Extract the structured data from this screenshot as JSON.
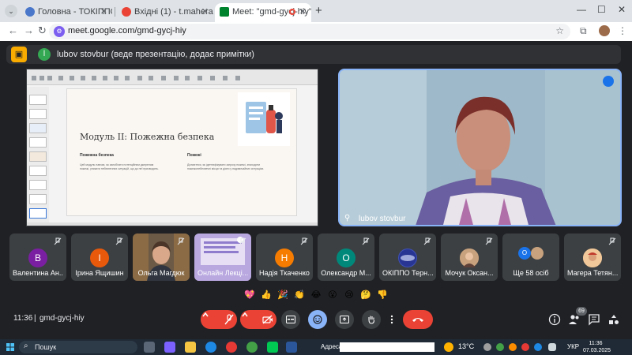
{
  "browser": {
    "tabs": [
      {
        "title": "Головна - ТОКІППО",
        "active": false,
        "favicon_color": "#4a77c9"
      },
      {
        "title": "Вхідні (1) - t.mahera@ippo.ed...",
        "active": false,
        "favicon_color": "#ea4335"
      },
      {
        "title": "Meet: \"gmd-gycj-hiy\"",
        "active": true,
        "favicon_color": "#00832d"
      }
    ],
    "url": "meet.google.com/gmd-gycj-hiy"
  },
  "presentation_bar": {
    "initial": "l",
    "text": "lubov stovbur (веде презентацію, додає примітки)"
  },
  "slide": {
    "title": "Модуль ІІ: Пожежна безпека",
    "left_heading": "Пожежна безпека",
    "left_text": "Цей модуль навчає, як запобігати потенційним джерелам пожежі, уникати небезпечних ситуацій, що до неї призводять.",
    "right_heading": "Пожежі",
    "right_text": "Дізнаєтеся, як ідентифікувати загрозу пожежі, знаходити пожежонебезпечні місця та діяти у надзвичайних ситуаціях."
  },
  "speaker": {
    "name": "lubov stovbur"
  },
  "participants": [
    {
      "name": "Валентина Ан...",
      "initial": "В",
      "avatar_color": "#7b1fa2",
      "type": "initial"
    },
    {
      "name": "Ірина Ящишин",
      "initial": "І",
      "avatar_color": "#e8590c",
      "type": "initial"
    },
    {
      "name": "Ольга Магдюк",
      "initial": "",
      "avatar_color": "#6d5a46",
      "type": "video"
    },
    {
      "name": "Онлайн Лекці...",
      "initial": "",
      "avatar_color": "#9c8fd0",
      "type": "video"
    },
    {
      "name": "Надія Ткаченко",
      "initial": "Н",
      "avatar_color": "#f57c00",
      "type": "initial"
    },
    {
      "name": "Олександр М...",
      "initial": "О",
      "avatar_color": "#00897b",
      "type": "initial"
    },
    {
      "name": "ОКІППО Терн...",
      "initial": "",
      "avatar_color": "#3f51b5",
      "type": "photo"
    },
    {
      "name": "Мочук Оксан...",
      "initial": "",
      "avatar_color": "#b08968",
      "type": "photo"
    },
    {
      "name": "Ще 58 осіб",
      "initial": "",
      "avatar_color": "#1a73e8",
      "type": "more"
    },
    {
      "name": "Магера Тетян...",
      "initial": "",
      "avatar_color": "#e0a96d",
      "type": "photo"
    }
  ],
  "reactions": [
    "💖",
    "👍",
    "🎉",
    "👏",
    "😂",
    "😮",
    "😢",
    "🤔",
    "👎"
  ],
  "controls": {
    "time": "11:36",
    "separator": "|",
    "meeting_code": "gmd-gycj-hiy",
    "people_count": "69"
  },
  "taskbar": {
    "search": "Пошук",
    "address_label": "Адреса",
    "temperature": "13°C",
    "language": "УКР",
    "time": "11:36",
    "date": "07.03.2025"
  },
  "colors": {
    "meet_bg": "#202124",
    "tile_bg": "#3c4043",
    "accent_blue": "#8ab4f8",
    "hangup_red": "#ea4335"
  }
}
